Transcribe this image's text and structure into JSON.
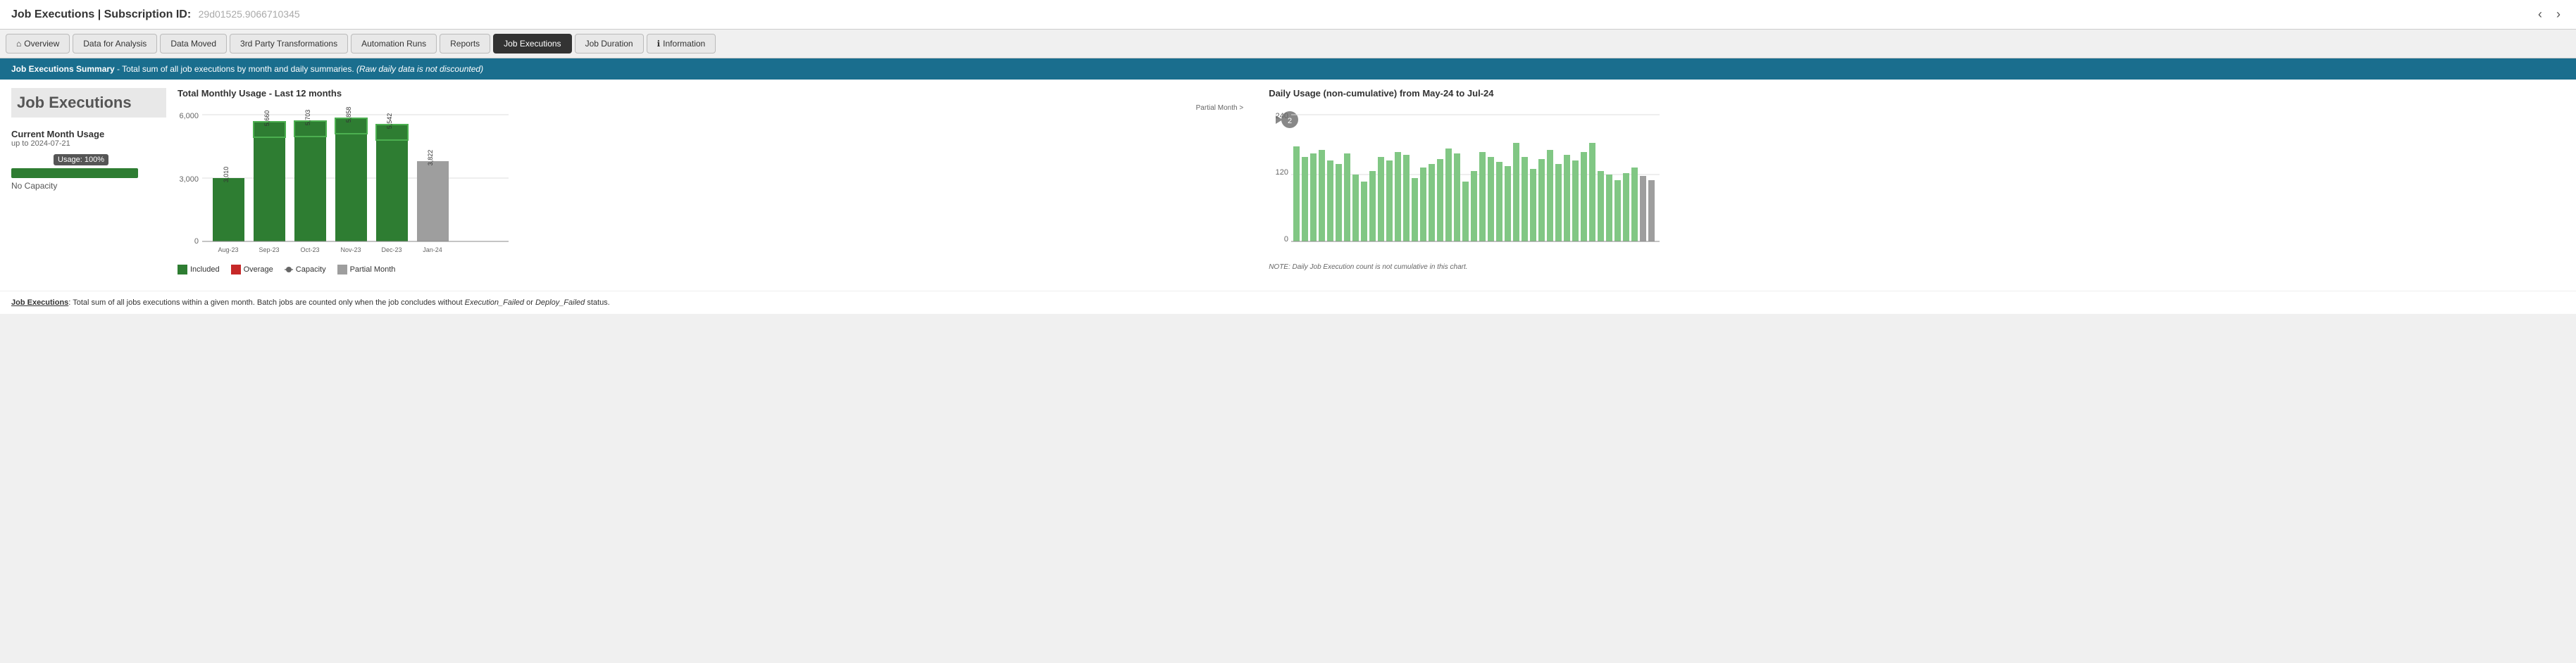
{
  "app": {
    "title": "Job Executions | Subscription ID:",
    "subscription_id": "29d01525.9066710345"
  },
  "nav": {
    "prev_label": "‹",
    "next_label": "›",
    "tabs": [
      {
        "id": "overview",
        "label": "Overview",
        "icon": "home",
        "active": false
      },
      {
        "id": "data-for-analysis",
        "label": "Data for Analysis",
        "active": false
      },
      {
        "id": "data-moved",
        "label": "Data Moved",
        "active": false
      },
      {
        "id": "3rd-party",
        "label": "3rd Party Transformations",
        "active": false
      },
      {
        "id": "automation-runs",
        "label": "Automation Runs",
        "active": false
      },
      {
        "id": "reports",
        "label": "Reports",
        "active": false
      },
      {
        "id": "job-executions",
        "label": "Job Executions",
        "active": true
      },
      {
        "id": "job-duration",
        "label": "Job Duration",
        "active": false
      },
      {
        "id": "information",
        "label": "Information",
        "icon": "info",
        "active": false
      }
    ]
  },
  "summary_bar": {
    "label": "Job Executions Summary",
    "text": " - Total sum of all job executions by month and daily summaries.",
    "note": "(Raw daily data is not discounted)"
  },
  "left_panel": {
    "title": "Job Executions",
    "current_month_label": "Current Month Usage",
    "current_month_date": "up to 2024-07-21",
    "usage_tooltip": "Usage: 100%",
    "usage_percent": 100,
    "no_capacity": "No Capacity"
  },
  "middle_chart": {
    "title": "Total Monthly Usage - Last 12 months",
    "partial_label": "Partial Month >",
    "y_axis_labels": [
      "6,000",
      "3,000",
      "0"
    ],
    "bars": [
      {
        "label": "Aug-23",
        "value": 3010,
        "type": "included"
      },
      {
        "label": "Sep-23",
        "value": 5660,
        "type": "included"
      },
      {
        "label": "Oct-23",
        "value": 5703,
        "type": "included"
      },
      {
        "label": "Nov-23",
        "value": 5858,
        "type": "included"
      },
      {
        "label": "Dec-23",
        "value": 5542,
        "type": "included"
      },
      {
        "label": "Jan-24",
        "value": 3822,
        "type": "partial"
      }
    ],
    "bar_values": [
      "3,010",
      "5,660",
      "5,703",
      "5,858",
      "5,542",
      "3,822"
    ],
    "legend": [
      {
        "id": "included",
        "label": "Included",
        "color": "#2e7d32"
      },
      {
        "id": "overage",
        "label": "Overage",
        "color": "#c62828"
      },
      {
        "id": "capacity",
        "label": "Capacity",
        "type": "dot"
      },
      {
        "id": "partial",
        "label": "Partial Month",
        "color": "#9e9e9e"
      }
    ]
  },
  "right_chart": {
    "title": "Daily Usage (non-cumulative) from May-24 to Jul-24",
    "badge": "2",
    "y_axis_labels": [
      "240",
      "120",
      "0"
    ],
    "note": "NOTE: Daily Job Execution count is not cumulative in this chart."
  },
  "footer": {
    "link_text": "Job Executions",
    "description": ": Total sum of all jobs executions within a given month. Batch jobs are counted only when the job concludes without",
    "italic_text": "Execution_Failed",
    "or_text": " or ",
    "italic_text2": "Deploy_Failed",
    "end_text": " status."
  }
}
